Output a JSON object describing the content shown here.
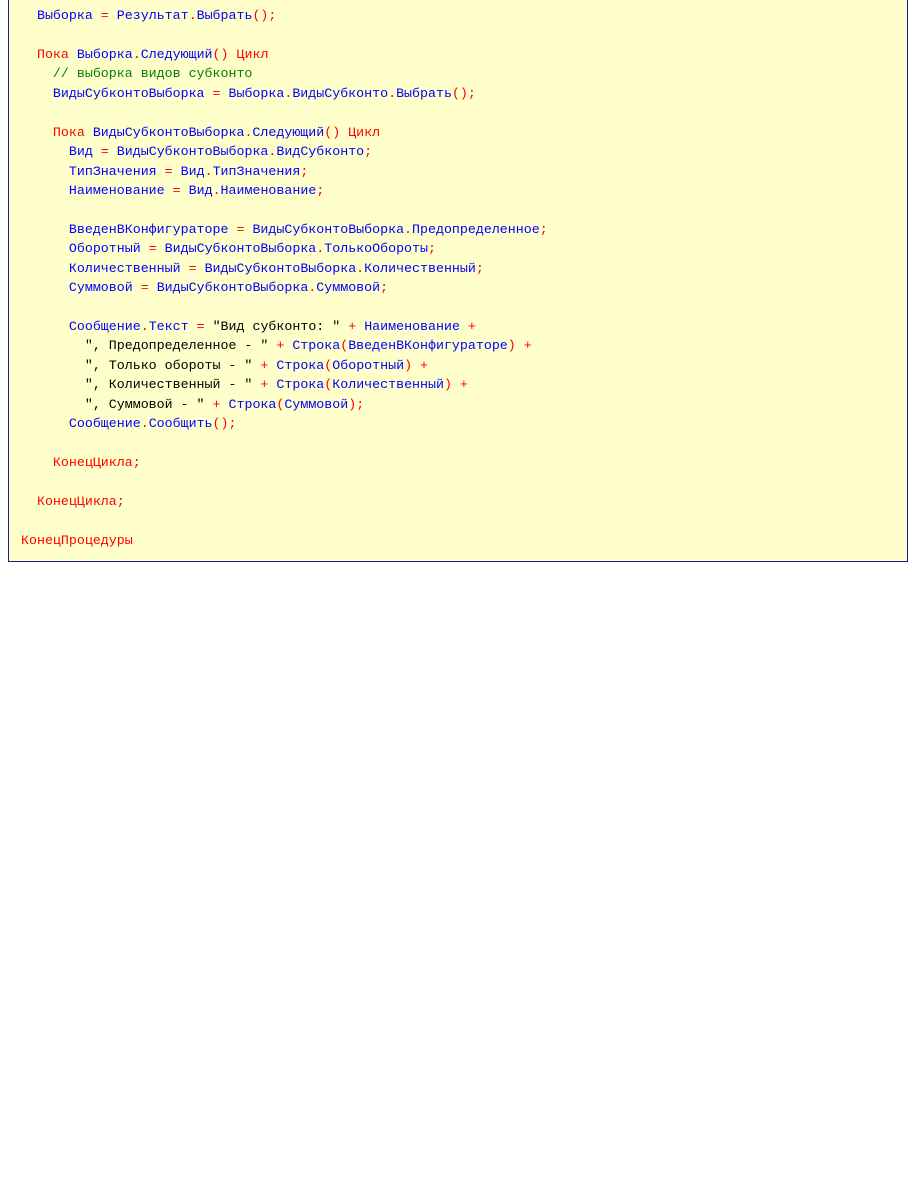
{
  "code_panel": {
    "lines": [
      [
        {
          "t": "  ",
          "k": "ws"
        },
        {
          "t": "Выборка",
          "k": "id"
        },
        {
          "t": " = ",
          "k": "op"
        },
        {
          "t": "Результат",
          "k": "id"
        },
        {
          "t": ".",
          "k": "op"
        },
        {
          "t": "Выбрать",
          "k": "id"
        },
        {
          "t": "();",
          "k": "op"
        }
      ],
      [],
      [
        {
          "t": "  ",
          "k": "ws"
        },
        {
          "t": "Пока",
          "k": "kw"
        },
        {
          "t": " ",
          "k": "ws"
        },
        {
          "t": "Выборка",
          "k": "id"
        },
        {
          "t": ".",
          "k": "op"
        },
        {
          "t": "Следующий",
          "k": "id"
        },
        {
          "t": "() ",
          "k": "op"
        },
        {
          "t": "Цикл",
          "k": "kw"
        }
      ],
      [
        {
          "t": "    ",
          "k": "ws"
        },
        {
          "t": "// выборка видов субконто",
          "k": "cm"
        }
      ],
      [
        {
          "t": "    ",
          "k": "ws"
        },
        {
          "t": "ВидыСубконтоВыборка",
          "k": "id"
        },
        {
          "t": " = ",
          "k": "op"
        },
        {
          "t": "Выборка",
          "k": "id"
        },
        {
          "t": ".",
          "k": "op"
        },
        {
          "t": "ВидыСубконто",
          "k": "id"
        },
        {
          "t": ".",
          "k": "op"
        },
        {
          "t": "Выбрать",
          "k": "id"
        },
        {
          "t": "();",
          "k": "op"
        }
      ],
      [],
      [
        {
          "t": "    ",
          "k": "ws"
        },
        {
          "t": "Пока",
          "k": "kw"
        },
        {
          "t": " ",
          "k": "ws"
        },
        {
          "t": "ВидыСубконтоВыборка",
          "k": "id"
        },
        {
          "t": ".",
          "k": "op"
        },
        {
          "t": "Следующий",
          "k": "id"
        },
        {
          "t": "() ",
          "k": "op"
        },
        {
          "t": "Цикл",
          "k": "kw"
        }
      ],
      [
        {
          "t": "      ",
          "k": "ws"
        },
        {
          "t": "Вид",
          "k": "id"
        },
        {
          "t": " = ",
          "k": "op"
        },
        {
          "t": "ВидыСубконтоВыборка",
          "k": "id"
        },
        {
          "t": ".",
          "k": "op"
        },
        {
          "t": "ВидСубконто",
          "k": "id"
        },
        {
          "t": ";",
          "k": "op"
        }
      ],
      [
        {
          "t": "      ",
          "k": "ws"
        },
        {
          "t": "ТипЗначения",
          "k": "id"
        },
        {
          "t": " = ",
          "k": "op"
        },
        {
          "t": "Вид",
          "k": "id"
        },
        {
          "t": ".",
          "k": "op"
        },
        {
          "t": "ТипЗначения",
          "k": "id"
        },
        {
          "t": ";",
          "k": "op"
        }
      ],
      [
        {
          "t": "      ",
          "k": "ws"
        },
        {
          "t": "Наименование",
          "k": "id"
        },
        {
          "t": " = ",
          "k": "op"
        },
        {
          "t": "Вид",
          "k": "id"
        },
        {
          "t": ".",
          "k": "op"
        },
        {
          "t": "Наименование",
          "k": "id"
        },
        {
          "t": ";",
          "k": "op"
        }
      ],
      [],
      [
        {
          "t": "      ",
          "k": "ws"
        },
        {
          "t": "ВведенВКонфигураторе",
          "k": "id"
        },
        {
          "t": " = ",
          "k": "op"
        },
        {
          "t": "ВидыСубконтоВыборка",
          "k": "id"
        },
        {
          "t": ".",
          "k": "op"
        },
        {
          "t": "Предопределенное",
          "k": "id"
        },
        {
          "t": ";",
          "k": "op"
        }
      ],
      [
        {
          "t": "      ",
          "k": "ws"
        },
        {
          "t": "Оборотный",
          "k": "id"
        },
        {
          "t": " = ",
          "k": "op"
        },
        {
          "t": "ВидыСубконтоВыборка",
          "k": "id"
        },
        {
          "t": ".",
          "k": "op"
        },
        {
          "t": "ТолькоОбороты",
          "k": "id"
        },
        {
          "t": ";",
          "k": "op"
        }
      ],
      [
        {
          "t": "      ",
          "k": "ws"
        },
        {
          "t": "Количественный",
          "k": "id"
        },
        {
          "t": " = ",
          "k": "op"
        },
        {
          "t": "ВидыСубконтоВыборка",
          "k": "id"
        },
        {
          "t": ".",
          "k": "op"
        },
        {
          "t": "Количественный",
          "k": "id"
        },
        {
          "t": ";",
          "k": "op"
        }
      ],
      [
        {
          "t": "      ",
          "k": "ws"
        },
        {
          "t": "Суммовой",
          "k": "id"
        },
        {
          "t": " = ",
          "k": "op"
        },
        {
          "t": "ВидыСубконтоВыборка",
          "k": "id"
        },
        {
          "t": ".",
          "k": "op"
        },
        {
          "t": "Суммовой",
          "k": "id"
        },
        {
          "t": ";",
          "k": "op"
        }
      ],
      [],
      [
        {
          "t": "      ",
          "k": "ws"
        },
        {
          "t": "Сообщение",
          "k": "id"
        },
        {
          "t": ".",
          "k": "op"
        },
        {
          "t": "Текст",
          "k": "id"
        },
        {
          "t": " = ",
          "k": "op"
        },
        {
          "t": "\"Вид субконто: \"",
          "k": "str"
        },
        {
          "t": " + ",
          "k": "op"
        },
        {
          "t": "Наименование",
          "k": "id"
        },
        {
          "t": " +",
          "k": "op"
        }
      ],
      [
        {
          "t": "        ",
          "k": "ws"
        },
        {
          "t": "\", Предопределенное - \"",
          "k": "str"
        },
        {
          "t": " + ",
          "k": "op"
        },
        {
          "t": "Строка",
          "k": "id"
        },
        {
          "t": "(",
          "k": "op"
        },
        {
          "t": "ВведенВКонфигураторе",
          "k": "id"
        },
        {
          "t": ") +",
          "k": "op"
        }
      ],
      [
        {
          "t": "        ",
          "k": "ws"
        },
        {
          "t": "\", Только обороты - \"",
          "k": "str"
        },
        {
          "t": " + ",
          "k": "op"
        },
        {
          "t": "Строка",
          "k": "id"
        },
        {
          "t": "(",
          "k": "op"
        },
        {
          "t": "Оборотный",
          "k": "id"
        },
        {
          "t": ") +",
          "k": "op"
        }
      ],
      [
        {
          "t": "        ",
          "k": "ws"
        },
        {
          "t": "\", Количественный - \"",
          "k": "str"
        },
        {
          "t": " + ",
          "k": "op"
        },
        {
          "t": "Строка",
          "k": "id"
        },
        {
          "t": "(",
          "k": "op"
        },
        {
          "t": "Количественный",
          "k": "id"
        },
        {
          "t": ") +",
          "k": "op"
        }
      ],
      [
        {
          "t": "        ",
          "k": "ws"
        },
        {
          "t": "\", Суммовой - \"",
          "k": "str"
        },
        {
          "t": " + ",
          "k": "op"
        },
        {
          "t": "Строка",
          "k": "id"
        },
        {
          "t": "(",
          "k": "op"
        },
        {
          "t": "Суммовой",
          "k": "id"
        },
        {
          "t": ");",
          "k": "op"
        }
      ],
      [
        {
          "t": "      ",
          "k": "ws"
        },
        {
          "t": "Сообщение",
          "k": "id"
        },
        {
          "t": ".",
          "k": "op"
        },
        {
          "t": "Сообщить",
          "k": "id"
        },
        {
          "t": "();",
          "k": "op"
        }
      ],
      [],
      [
        {
          "t": "    ",
          "k": "ws"
        },
        {
          "t": "КонецЦикла",
          "k": "kw"
        },
        {
          "t": ";",
          "k": "op"
        }
      ],
      [],
      [
        {
          "t": "  ",
          "k": "ws"
        },
        {
          "t": "КонецЦикла",
          "k": "kw"
        },
        {
          "t": ";",
          "k": "op"
        }
      ],
      [],
      [
        {
          "t": "КонецПроцедуры",
          "k": "kw"
        }
      ]
    ]
  }
}
